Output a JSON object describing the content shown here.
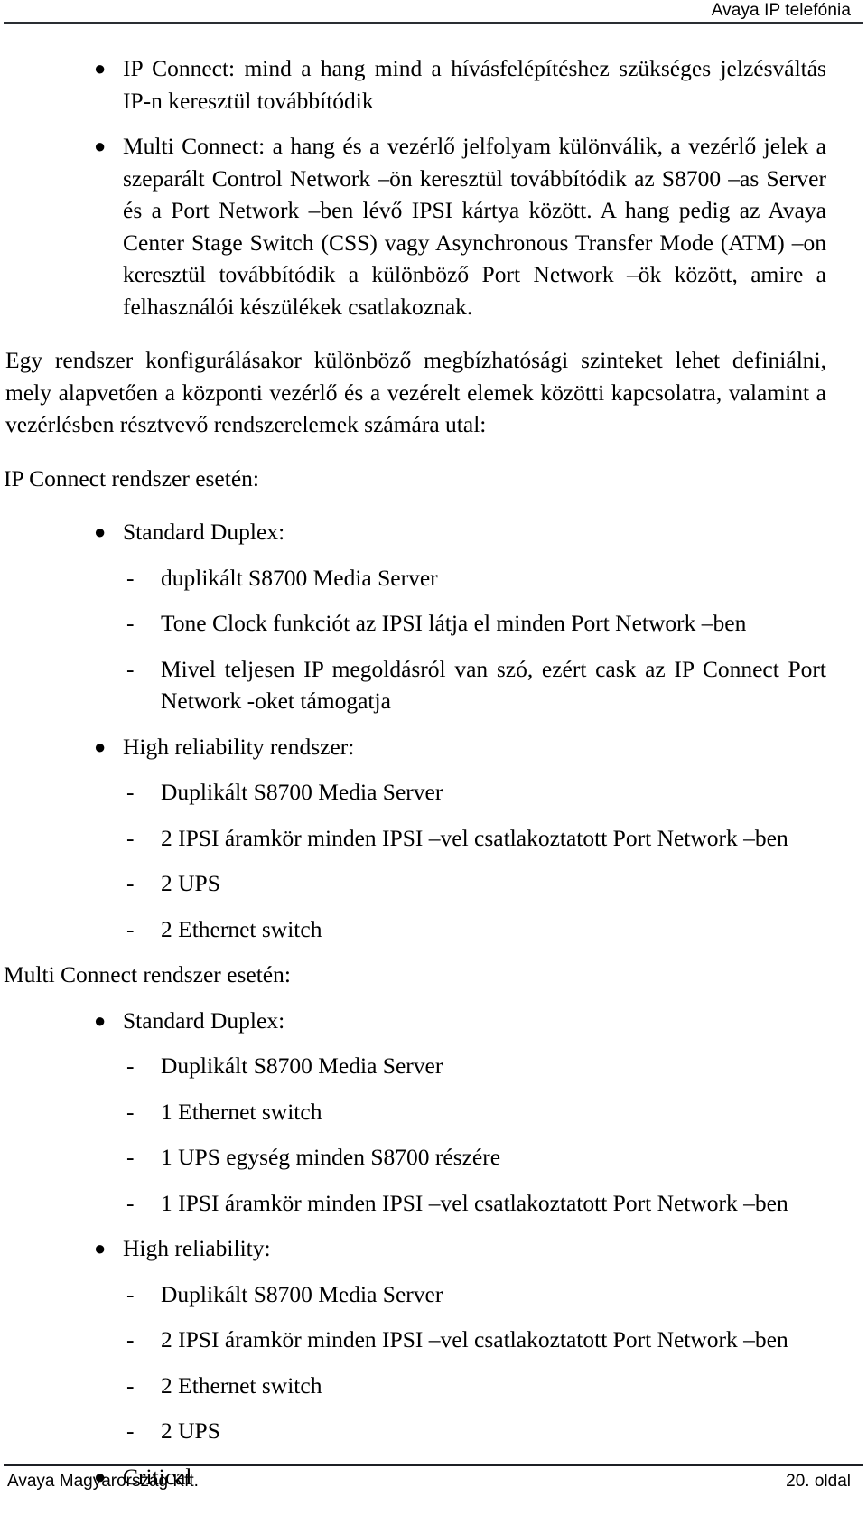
{
  "header": {
    "title": "Avaya IP telefónia"
  },
  "body": {
    "bullet_marker": "●",
    "dash_marker": "-",
    "intro_bullets": [
      "IP Connect: mind a hang mind a hívásfelépítéshez szükséges jelzésváltás IP-n keresztül továbbítódik",
      "Multi Connect: a hang és a vezérlő jelfolyam különválik, a vezérlő jelek a szeparált Control Network –ön keresztül továbbítódik az S8700 –as Server és a Port Network –ben lévő IPSI kártya között. A hang pedig az Avaya Center Stage Switch (CSS) vagy  Asynchronous Transfer Mode (ATM) –on keresztül továbbítódik a különböző Port Network –ök között, amire a felhasználói készülékek csatlakoznak."
    ],
    "paragraph": "Egy rendszer konfigurálásakor különböző megbízhatósági szinteket lehet definiálni, mely alapvetően a központi vezérlő és a vezérelt elemek közötti kapcsolatra, valamint a vezérlésben résztvevő rendszerelemek számára utal:",
    "sections": [
      {
        "lead": "IP Connect rendszer esetén:",
        "groups": [
          {
            "label": "Standard Duplex:",
            "items": [
              "duplikált S8700 Media Server",
              "Tone Clock funkciót az IPSI látja el minden Port Network –ben",
              "Mivel teljesen IP megoldásról van szó, ezért cask az IP Connect Port Network -oket támogatja"
            ]
          },
          {
            "label": "High reliability rendszer:",
            "items": [
              "Duplikált S8700 Media Server",
              "2 IPSI áramkör minden IPSI –vel csatlakoztatott Port Network –ben",
              "2 UPS",
              "2 Ethernet switch"
            ]
          }
        ]
      },
      {
        "lead": "Multi Connect rendszer esetén:",
        "groups": [
          {
            "label": "Standard Duplex:",
            "items": [
              "Duplikált S8700 Media Server",
              "1 Ethernet switch",
              "1 UPS egység minden S8700 részére",
              "1 IPSI áramkör minden IPSI –vel csatlakoztatott Port Network –ben"
            ]
          },
          {
            "label": "High reliability:",
            "items": [
              "Duplikált S8700 Media Server",
              "2 IPSI áramkör minden IPSI –vel csatlakoztatott Port Network –ben",
              "2 Ethernet switch",
              "2 UPS"
            ]
          },
          {
            "label": "Critical",
            "items": []
          }
        ]
      }
    ]
  },
  "footer": {
    "left": "Avaya Magyarország Kft.",
    "right": "20. oldal"
  }
}
